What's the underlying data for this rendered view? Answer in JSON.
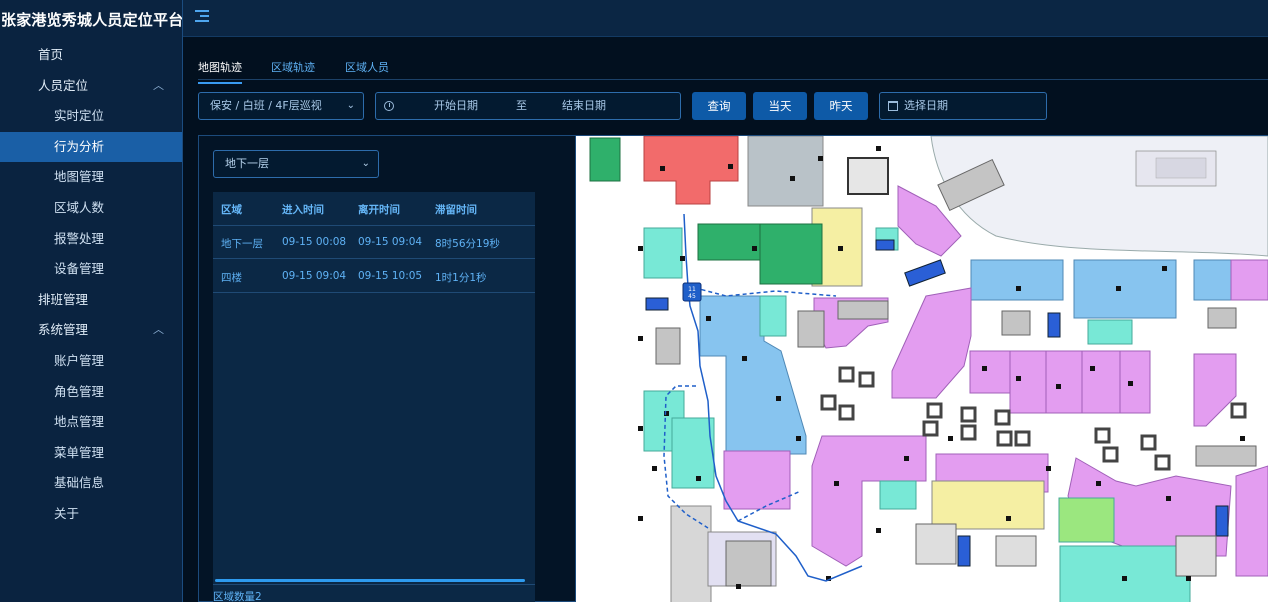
{
  "app": {
    "title": "张家港览秀城人员定位平台"
  },
  "sidebar": {
    "items": [
      {
        "label": "首页",
        "level": 1
      },
      {
        "label": "人员定位",
        "level": 1,
        "expanded": true
      },
      {
        "label": "实时定位",
        "level": 2
      },
      {
        "label": "行为分析",
        "level": 2,
        "active": true
      },
      {
        "label": "地图管理",
        "level": 2
      },
      {
        "label": "区域人数",
        "level": 2
      },
      {
        "label": "报警处理",
        "level": 2
      },
      {
        "label": "设备管理",
        "level": 2
      },
      {
        "label": "排班管理",
        "level": 1
      },
      {
        "label": "系统管理",
        "level": 1,
        "expanded": true
      },
      {
        "label": "账户管理",
        "level": 2
      },
      {
        "label": "角色管理",
        "level": 2
      },
      {
        "label": "地点管理",
        "level": 2
      },
      {
        "label": "菜单管理",
        "level": 2
      },
      {
        "label": "基础信息",
        "level": 2
      },
      {
        "label": "关于",
        "level": 2
      }
    ]
  },
  "tabs": [
    {
      "label": "地图轨迹",
      "active": true
    },
    {
      "label": "区域轨迹"
    },
    {
      "label": "区域人员"
    }
  ],
  "toolbar": {
    "person_select": "保安 / 白班 / 4F层巡视",
    "start_placeholder": "开始日期",
    "range_separator": "至",
    "end_placeholder": "结束日期",
    "query_label": "查询",
    "today_label": "当天",
    "yesterday_label": "昨天",
    "date_placeholder": "选择日期"
  },
  "panel": {
    "floor_select": "地下一层",
    "columns": [
      "区域",
      "进入时间",
      "离开时间",
      "滞留时间"
    ],
    "rows": [
      [
        "地下一层",
        "09-15 00:08",
        "09-15 09:04",
        "8时56分19秒"
      ],
      [
        "四楼",
        "09-15 09:04",
        "09-15 10:05",
        "1时1分1秒"
      ]
    ],
    "footer": "区域数量2"
  },
  "map": {
    "marker_label": "11\n45",
    "colors": {
      "magenta": "#e39df0",
      "lightblue": "#87c4ef",
      "teal": "#78e8d6",
      "green": "#2fb06b",
      "red": "#f26b6b",
      "yellow": "#f5efa3",
      "route": "#1f5fc9"
    }
  }
}
